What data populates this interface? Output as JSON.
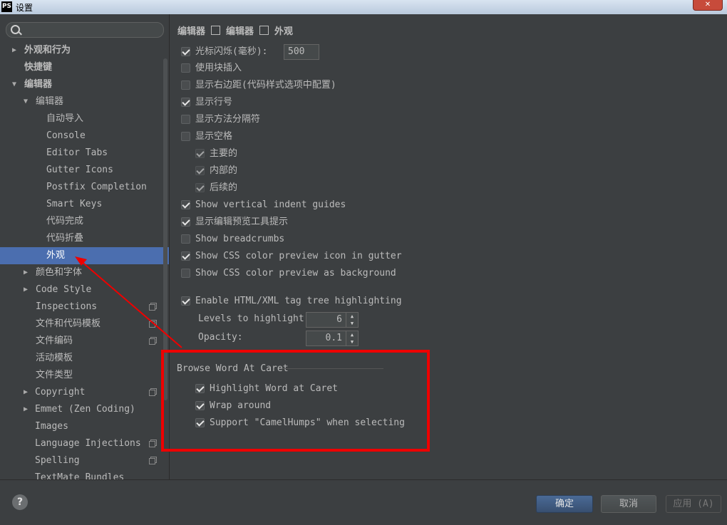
{
  "window": {
    "title": "设置",
    "app_logo": "PS"
  },
  "sidebar": {
    "items": [
      {
        "label": "外观和行为",
        "arrow": "▶"
      },
      {
        "label": "快捷键",
        "arrow": ""
      },
      {
        "label": "编辑器",
        "arrow": "▼"
      },
      {
        "label": "编辑器",
        "arrow": "▼"
      },
      {
        "label": "自动导入",
        "arrow": ""
      },
      {
        "label": "Console",
        "arrow": ""
      },
      {
        "label": "Editor Tabs",
        "arrow": ""
      },
      {
        "label": "Gutter Icons",
        "arrow": ""
      },
      {
        "label": "Postfix Completion",
        "arrow": ""
      },
      {
        "label": "Smart Keys",
        "arrow": ""
      },
      {
        "label": "代码完成",
        "arrow": ""
      },
      {
        "label": "代码折叠",
        "arrow": ""
      },
      {
        "label": "外观",
        "arrow": ""
      },
      {
        "label": "颜色和字体",
        "arrow": "▶"
      },
      {
        "label": "Code Style",
        "arrow": "▶"
      },
      {
        "label": "Inspections",
        "arrow": ""
      },
      {
        "label": "文件和代码模板",
        "arrow": ""
      },
      {
        "label": "文件编码",
        "arrow": ""
      },
      {
        "label": "活动模板",
        "arrow": ""
      },
      {
        "label": "文件类型",
        "arrow": ""
      },
      {
        "label": "Copyright",
        "arrow": "▶"
      },
      {
        "label": "Emmet (Zen Coding)",
        "arrow": "▶"
      },
      {
        "label": "Images",
        "arrow": ""
      },
      {
        "label": "Language Injections",
        "arrow": ""
      },
      {
        "label": "Spelling",
        "arrow": ""
      },
      {
        "label": "TextMate Bundles",
        "arrow": ""
      }
    ]
  },
  "breadcrumb": {
    "part1": "编辑器",
    "part2": "编辑器",
    "part3": "外观"
  },
  "options": {
    "caret_blink": {
      "label": "光标闪烁(毫秒):",
      "checked": true,
      "value": "500"
    },
    "block_insert": {
      "label": "使用块插入",
      "checked": false
    },
    "right_margin": {
      "label": "显示右边距(代码样式选项中配置)",
      "checked": false
    },
    "line_numbers": {
      "label": "显示行号",
      "checked": true
    },
    "method_separators": {
      "label": "显示方法分隔符",
      "checked": false
    },
    "whitespace": {
      "label": "显示空格",
      "checked": false
    },
    "ws_leading": {
      "label": "主要的",
      "checked": true
    },
    "ws_inner": {
      "label": "内部的",
      "checked": true
    },
    "ws_trailing": {
      "label": "后续的",
      "checked": true
    },
    "indent_guides": {
      "label": "Show vertical indent guides",
      "checked": true
    },
    "code_lens": {
      "label": "显示编辑预览工具提示",
      "checked": true
    },
    "breadcrumbs": {
      "label": "Show breadcrumbs",
      "checked": false
    },
    "css_gutter": {
      "label": "Show CSS color preview icon in gutter",
      "checked": true
    },
    "css_bg": {
      "label": "Show CSS color preview as background",
      "checked": false
    },
    "html_tag_tree": {
      "label": "Enable HTML/XML tag tree highlighting",
      "checked": true
    },
    "levels": {
      "label": "Levels to highlight:",
      "value": "6"
    },
    "opacity": {
      "label": "Opacity:",
      "value": "0.1"
    }
  },
  "browse_word": {
    "title": "Browse Word At Caret",
    "highlight": {
      "label": "Highlight Word at Caret",
      "checked": true
    },
    "wrap": {
      "label": "Wrap around",
      "checked": true
    },
    "camel": {
      "label": "Support \"CamelHumps\" when selecting",
      "checked": true
    }
  },
  "buttons": {
    "ok": "确定",
    "cancel": "取消",
    "apply": "应用 (A)",
    "help": "?"
  },
  "colors": {
    "selection": "#4b6eaf",
    "annotation": "#ee0000"
  }
}
